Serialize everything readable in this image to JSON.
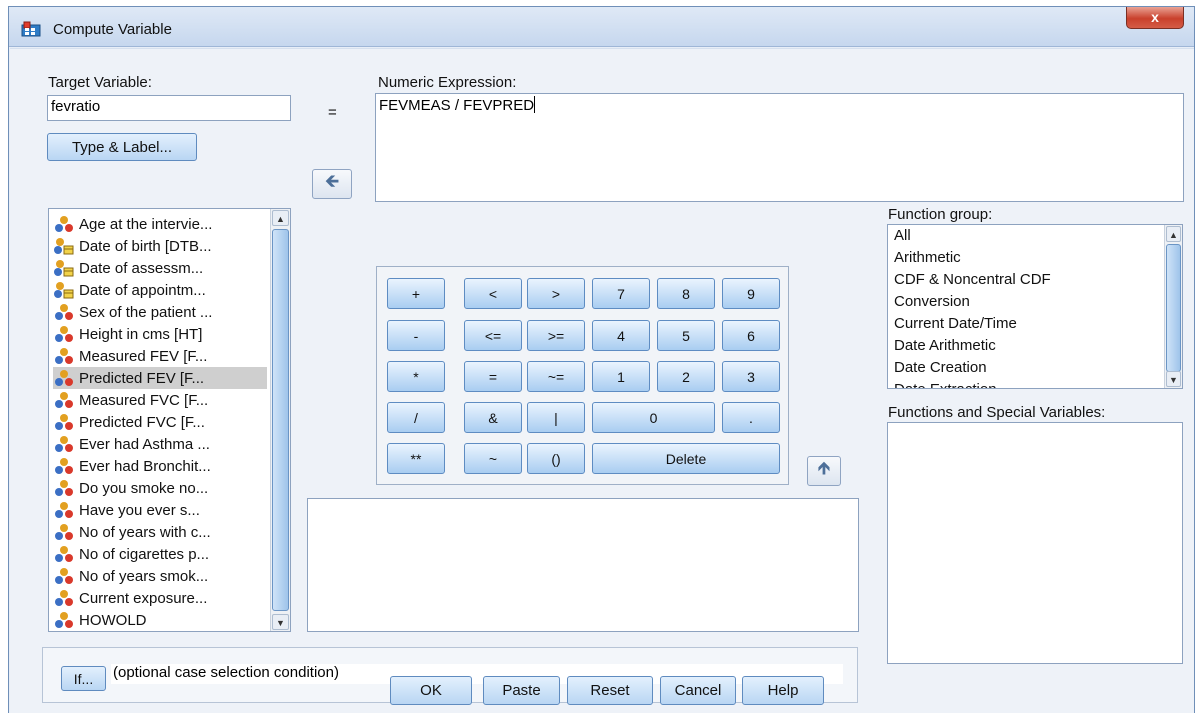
{
  "window": {
    "title": "Compute Variable",
    "close_glyph": "x"
  },
  "target": {
    "label_pre": "T",
    "label_u": "",
    "label_text": "Target Variable:",
    "value": "fevratio"
  },
  "equals": "=",
  "type_label_button": "Type & Label...",
  "numeric": {
    "label": "Numeric Expression:",
    "value": "FEVMEAS / FEVPRED"
  },
  "variables": [
    {
      "label": "Age at the intervie...",
      "type": "scale",
      "selected": false
    },
    {
      "label": "Date of birth [DTB...",
      "type": "date",
      "selected": false
    },
    {
      "label": "Date of assessm...",
      "type": "date",
      "selected": false
    },
    {
      "label": "Date of appointm...",
      "type": "date",
      "selected": false
    },
    {
      "label": "Sex of the patient ...",
      "type": "scale",
      "selected": false
    },
    {
      "label": "Height in cms [HT]",
      "type": "scale",
      "selected": false
    },
    {
      "label": "Measured FEV [F...",
      "type": "scale",
      "selected": false
    },
    {
      "label": "Predicted FEV [F...",
      "type": "scale",
      "selected": true
    },
    {
      "label": "Measured FVC [F...",
      "type": "scale",
      "selected": false
    },
    {
      "label": "Predicted FVC [F...",
      "type": "scale",
      "selected": false
    },
    {
      "label": "Ever had Asthma ...",
      "type": "scale",
      "selected": false
    },
    {
      "label": "Ever had Bronchit...",
      "type": "scale",
      "selected": false
    },
    {
      "label": "Do you smoke no...",
      "type": "scale",
      "selected": false
    },
    {
      "label": "Have you ever s...",
      "type": "scale",
      "selected": false
    },
    {
      "label": "No of years with c...",
      "type": "scale",
      "selected": false
    },
    {
      "label": "No of cigarettes p...",
      "type": "scale",
      "selected": false
    },
    {
      "label": "No of years smok...",
      "type": "scale",
      "selected": false
    },
    {
      "label": "Current exposure...",
      "type": "scale",
      "selected": false
    },
    {
      "label": "HOWOLD",
      "type": "scale",
      "selected": false
    }
  ],
  "keypad": [
    [
      "+",
      "<",
      ">",
      "7",
      "8",
      "9"
    ],
    [
      "-",
      "<=",
      ">=",
      "4",
      "5",
      "6"
    ],
    [
      "*",
      "=",
      "~=",
      "1",
      "2",
      "3"
    ],
    [
      "/",
      "&",
      "|",
      "0",
      "."
    ],
    [
      "**",
      "~",
      "()",
      "Delete"
    ]
  ],
  "function_group": {
    "label": "Function group:",
    "items": [
      "All",
      "Arithmetic",
      "CDF & Noncentral CDF",
      "Conversion",
      "Current Date/Time",
      "Date Arithmetic",
      "Date Creation",
      "Date Extraction"
    ]
  },
  "functions_label": "Functions and Special Variables:",
  "if_section": {
    "button": "If...",
    "condition": "(optional case selection condition)"
  },
  "footer_buttons": [
    "OK",
    "Paste",
    "Reset",
    "Cancel",
    "Help"
  ],
  "icons": {
    "move_to_expression": "left-arrow-icon",
    "move_up": "up-arrow-icon"
  }
}
